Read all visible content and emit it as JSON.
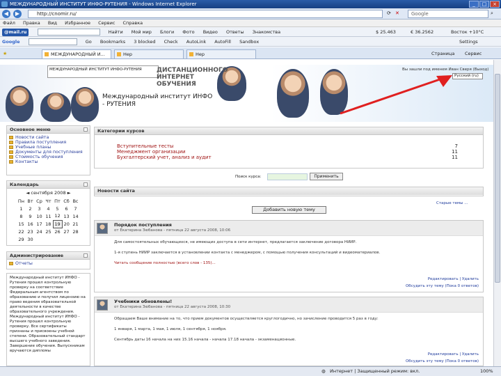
{
  "window": {
    "title": "МЕЖДУНАРОДНЫЙ ИНСТИТУТ ИНФО-РУТЕНИЯ - Windows Internet Explorer"
  },
  "address": {
    "url": "http://cnomir.ru/",
    "search_placeholder": "Google"
  },
  "menu": {
    "items": [
      "Файл",
      "Правка",
      "Вид",
      "Избранное",
      "Сервис",
      "Справка"
    ]
  },
  "mailbar": {
    "brand": "@mail.ru",
    "find": "Найти",
    "items": [
      "Мой мир",
      "Блоги",
      "Фото",
      "Видео",
      "Ответы",
      "Знакомства"
    ],
    "rates": [
      "$ 25.463",
      "€ 36.2562",
      "Восток +10°C"
    ]
  },
  "googlebar": {
    "brand": "Google",
    "go": "Go",
    "items": [
      "Bookmarks",
      "3 blocked",
      "Check",
      "AutoLink",
      "AutoFill",
      "Sandbox"
    ],
    "settings": "Settings"
  },
  "tabs": [
    {
      "label": "МЕЖДУНАРОДНЫЙ И...",
      "active": true
    },
    {
      "label": "Hep",
      "active": false
    },
    {
      "label": "Hep",
      "active": false
    }
  ],
  "tabtools": {
    "page": "Страница",
    "tools": "Сервис"
  },
  "header": {
    "note": "МЕЖДУНАРОДНЫЙ ИНСТИТУТ ИНФО-РУТЕНИЯ",
    "banner_top": "ДИСТАНЦИОННОГО ИНТЕРНЕТ ОБУЧЕНИЯ",
    "banner_main": "Международный институт ИНФО - РУТЕНИЯ",
    "login_text": "Вы зашли под именем Иван Сверя (Выход)",
    "language": "Русский (ru)"
  },
  "mainmenu": {
    "title": "Основное меню",
    "items": [
      "Новости сайта",
      "Правила поступления",
      "Учебные планы",
      "Документы для поступления",
      "Стоимость обучения",
      "Контакты"
    ]
  },
  "calendar": {
    "title": "Календарь",
    "month": "сентября 2008",
    "days": [
      "Пн",
      "Вт",
      "Ср",
      "Чт",
      "Пт",
      "Сб",
      "Вс"
    ],
    "weeks": [
      [
        "1",
        "2",
        "3",
        "4",
        "5",
        "6",
        "7"
      ],
      [
        "8",
        "9",
        "10",
        "11",
        "12",
        "13",
        "14"
      ],
      [
        "15",
        "16",
        "17",
        "18",
        "19",
        "20",
        "21"
      ],
      [
        "22",
        "23",
        "24",
        "25",
        "26",
        "27",
        "28"
      ],
      [
        "29",
        "30",
        "",
        "",
        "",
        "",
        ""
      ]
    ],
    "today": "19"
  },
  "admin": {
    "title": "Администрирование",
    "items": [
      "Отчеты"
    ]
  },
  "desc": {
    "text": "Международный институт ИНФО - Рутения прошел контрольную проверку на соответствие Федеральным агентством по образованию и получил лицензию на право ведения образовательной деятельности в качестве образовательного учреждения. Международный институт ИНФО - Рутения прошел контрольную проверку. Все сертификаты признаны и присвоены учебной степени. Образовательный стандарт высшего учебного заведения. Завершение обучения. Выпускникам вручаются дипломы"
  },
  "categories": {
    "title": "Категории курсов",
    "items": [
      {
        "name": "Вступительные тесты",
        "count": "7"
      },
      {
        "name": "Менеджмент организации",
        "count": "11"
      },
      {
        "name": "Бухгалтерский учет, анализ и аудит",
        "count": "11"
      }
    ],
    "search_label": "Поиск курса:",
    "search_button": "Применить"
  },
  "news": {
    "title": "Новости сайта",
    "add_button": "Добавить новую тему",
    "older_link": "Старые темы ...",
    "posts": [
      {
        "title": "Порядок поступления",
        "author": "от Екатерина Зюбанова - пятница 22 августа 2008, 10:06",
        "lines": [
          "Для самостоятельных обучающихся, не имеющих доступа в сети интернет, предлагается заключение договора НИИР.",
          "1-я ступень НИИР заключается в установлении контакта с менеджером, с помощью получения консультаций и видеоматериалов.",
          "Читать сообщение полностью (всего слов - 135)..."
        ],
        "actions": "Редактировать | Удалить",
        "discuss": "Обсудить эту тему (Пока 0 ответов)"
      },
      {
        "title": "Учебники обновлены!",
        "author": "от Екатерина Зюбанова - пятница 22 августа 2008, 10:30",
        "lines": [
          "Обращаем Ваше внимание на то, что прием документов осуществляется круглогодично, но зачисление проводится 5 раз в году:",
          "1 января, 1 марта, 1 мая, 1 июля, 1 сентября, 1 ноября.",
          "Сентябрь даты 16 начала на них 15.16 начала - начала 17.18 начала - экзаменационные."
        ],
        "actions": "Редактировать | Удалить",
        "discuss": "Обсудить эту тему (Пока 0 ответов)"
      }
    ]
  },
  "statusbar": {
    "zone": "Интернет | Защищенный режим: вкл.",
    "zoom": "100%"
  }
}
